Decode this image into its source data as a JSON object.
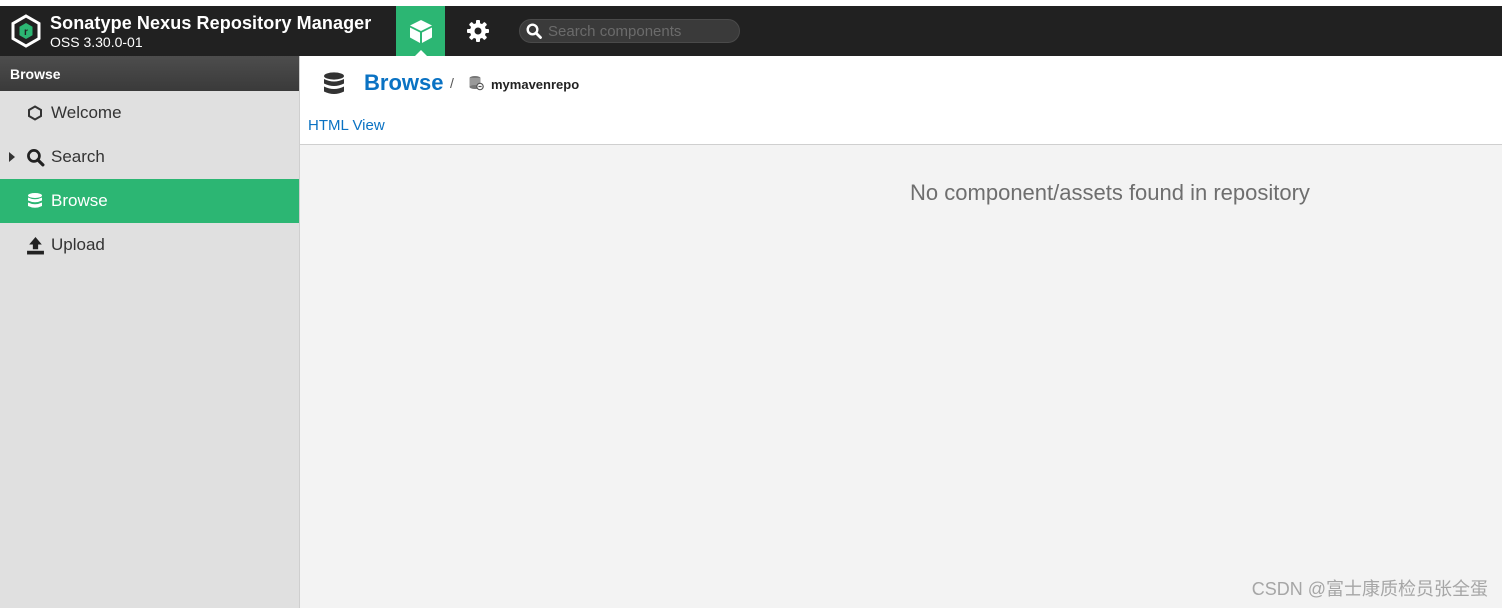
{
  "header": {
    "app_title": "Sonatype Nexus Repository Manager",
    "version": "OSS 3.30.0-01",
    "nav": {
      "browse_icon": "cube-icon",
      "admin_icon": "gear-icon"
    },
    "search": {
      "placeholder": "Search components",
      "value": ""
    }
  },
  "sidebar": {
    "title": "Browse",
    "items": [
      {
        "label": "Welcome",
        "icon": "hexagon-icon",
        "active": false
      },
      {
        "label": "Search",
        "icon": "search-icon",
        "active": false,
        "expandable": true
      },
      {
        "label": "Browse",
        "icon": "database-icon",
        "active": true
      },
      {
        "label": "Upload",
        "icon": "upload-icon",
        "active": false
      }
    ]
  },
  "main": {
    "breadcrumb": {
      "title": "Browse",
      "separator": "/",
      "repo": "mymavenrepo"
    },
    "html_view_link": "HTML View",
    "empty_message": "No component/assets found in repository"
  },
  "watermark": "CSDN @富士康质检员张全蛋",
  "colors": {
    "accent_green": "#2cb673",
    "topbar": "#212121",
    "link_blue": "#0a72c3",
    "sidebar_bg": "#e0e0e0",
    "content_bg": "#f3f3f3"
  }
}
